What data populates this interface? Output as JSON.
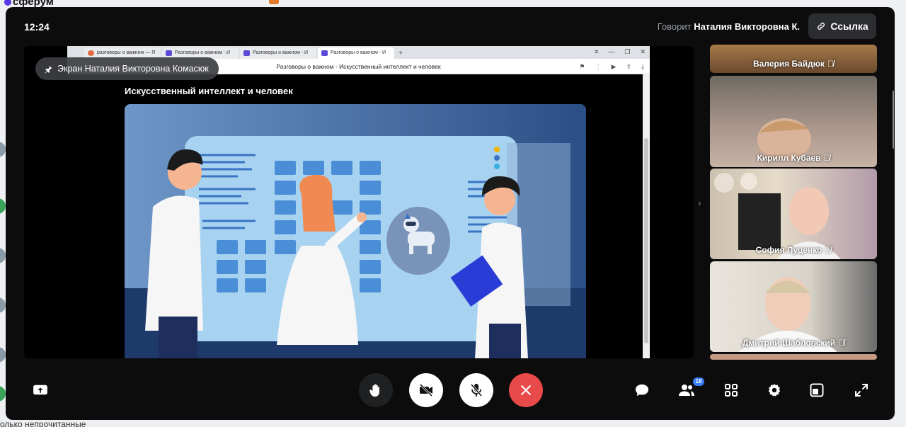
{
  "background_app": {
    "brand": "сферум",
    "unread_label": "олько непрочитанные"
  },
  "call": {
    "time": "12:24",
    "speaking_prefix": "Говорит",
    "speaking_name": "Наталия Викторовна К.",
    "link_label": "Ссылка",
    "screen_share_label": "Экран Наталия Викторовна Комасюк"
  },
  "browser": {
    "tabs": [
      {
        "label": "разговоры о важном — Я"
      },
      {
        "label": "Разговоры о важном - И"
      },
      {
        "label": "Разговоры о важном - И"
      },
      {
        "label": "Разговоры о важном - И"
      }
    ],
    "page_title": "Разговоры о важном - Искусственный интеллект и человек",
    "slide_heading": "Искусственный интеллект и человек"
  },
  "participants": [
    {
      "name": "Валерия Байдюк"
    },
    {
      "name": "Кирилл Кубаев"
    },
    {
      "name": "София Луценко"
    },
    {
      "name": "Дмитрий Шабловский"
    }
  ],
  "toolbar": {
    "participants_count": "18"
  },
  "colors": {
    "end_call": "#e84a4a",
    "badge": "#3a7bff",
    "window_bg": "#0c0c0d"
  }
}
